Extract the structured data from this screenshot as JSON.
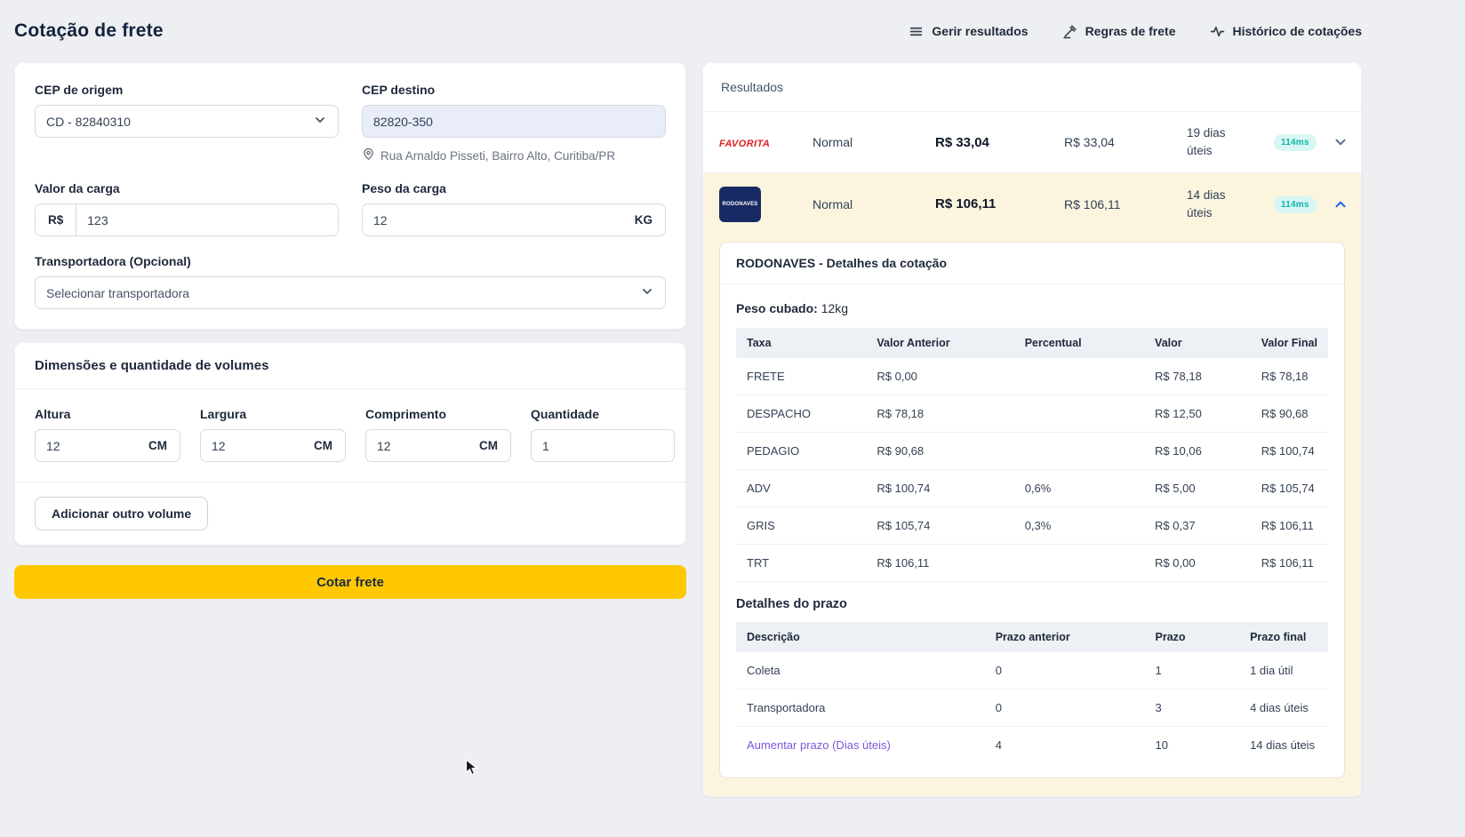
{
  "colors": {
    "accent_yellow": "#FFC800",
    "highlight_row_yellow": "#FBF5DF",
    "badge_teal_bg": "#D8F6F3",
    "badge_teal_text": "#0FB5AB",
    "link_purple": "#7F56D9",
    "favorita_red": "#E02020",
    "rodonaves_navy": "#182A63"
  },
  "page": {
    "title": "Cotação de frete"
  },
  "header": {
    "nav": [
      {
        "label": "Gerir resultados",
        "icon": "list-icon"
      },
      {
        "label": "Regras de frete",
        "icon": "gavel-icon"
      },
      {
        "label": "Histórico de cotações",
        "icon": "activity-icon"
      }
    ]
  },
  "form": {
    "origin": {
      "label": "CEP de origem",
      "value": "CD - 82840310"
    },
    "destination": {
      "label": "CEP destino",
      "value": "82820-350",
      "address": "Rua Arnaldo Pisseti, Bairro Alto, Curitiba/PR"
    },
    "cargo_value": {
      "label": "Valor da carga",
      "prefix": "R$",
      "value": "123"
    },
    "cargo_weight": {
      "label": "Peso da carga",
      "value": "12",
      "suffix": "KG"
    },
    "carrier": {
      "label": "Transportadora (Opcional)",
      "placeholder": "Selecionar transportadora"
    },
    "submit_label": "Cotar frete"
  },
  "volumes": {
    "title": "Dimensões e quantidade de volumes",
    "fields": [
      {
        "label": "Altura",
        "value": "12",
        "suffix": "CM"
      },
      {
        "label": "Largura",
        "value": "12",
        "suffix": "CM"
      },
      {
        "label": "Comprimento",
        "value": "12",
        "suffix": "CM"
      },
      {
        "label": "Quantidade",
        "value": "1"
      }
    ],
    "add_button": "Adicionar outro volume"
  },
  "results": {
    "title": "Resultados",
    "rows": [
      {
        "carrier": "FAVORITA",
        "service": "Normal",
        "price_final": "R$ 33,04",
        "price": "R$ 33,04",
        "deadline": "19 dias úteis",
        "latency": "114ms"
      },
      {
        "carrier": "RODONAVES",
        "service": "Normal",
        "price_final": "R$ 106,11",
        "price": "R$ 106,11",
        "deadline": "14 dias úteis",
        "latency": "114ms"
      }
    ],
    "details": {
      "title": "RODONAVES - Detalhes da cotação",
      "cubed_weight_label": "Peso cubado:",
      "cubed_weight_value": "12kg",
      "tax_table": {
        "headers": [
          "Taxa",
          "Valor Anterior",
          "Percentual",
          "Valor",
          "Valor Final"
        ],
        "rows": [
          [
            "FRETE",
            "R$ 0,00",
            "",
            "R$ 78,18",
            "R$ 78,18"
          ],
          [
            "DESPACHO",
            "R$ 78,18",
            "",
            "R$ 12,50",
            "R$ 90,68"
          ],
          [
            "PEDAGIO",
            "R$ 90,68",
            "",
            "R$ 10,06",
            "R$ 100,74"
          ],
          [
            "ADV",
            "R$ 100,74",
            "0,6%",
            "R$ 5,00",
            "R$ 105,74"
          ],
          [
            "GRIS",
            "R$ 105,74",
            "0,3%",
            "R$ 0,37",
            "R$ 106,11"
          ],
          [
            "TRT",
            "R$ 106,11",
            "",
            "R$ 0,00",
            "R$ 106,11"
          ]
        ]
      },
      "deadline_title": "Detalhes do prazo",
      "deadline_table": {
        "headers": [
          "Descrição",
          "Prazo anterior",
          "Prazo",
          "Prazo final"
        ],
        "rows": [
          [
            "Coleta",
            "0",
            "1",
            "1 dia útil"
          ],
          [
            "Transportadora",
            "0",
            "3",
            "4 dias úteis"
          ],
          [
            "Aumentar prazo (Dias úteis)",
            "4",
            "10",
            "14 dias úteis"
          ]
        ]
      }
    }
  }
}
